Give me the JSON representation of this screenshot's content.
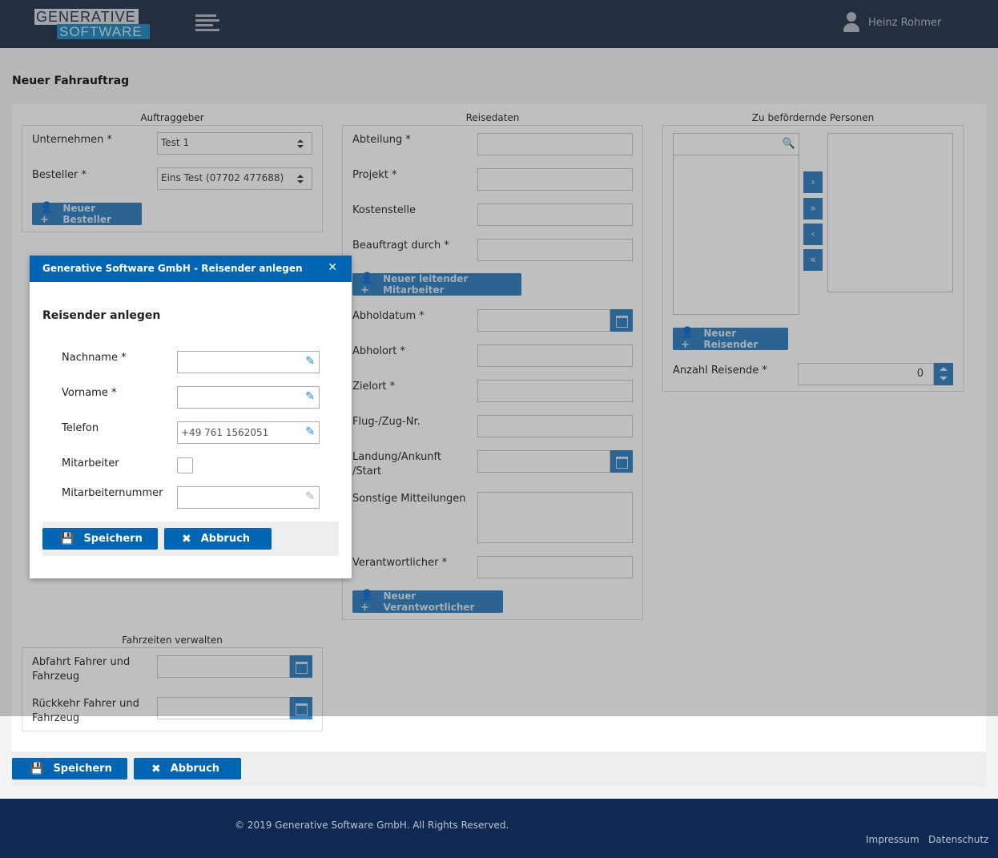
{
  "header": {
    "logo_top": "GENERATIVE",
    "logo_bottom": "SOFTWARE",
    "user_name": "Heinz Rohmer"
  },
  "page": {
    "title": "Neuer Fahrauftrag"
  },
  "auftraggeber": {
    "title": "Auftraggeber",
    "unternehmen_label": "Unternehmen  *",
    "unternehmen_value": "Test 1",
    "besteller_label": "Besteller  *",
    "besteller_value": "Eins Test (07702 477688)",
    "neuer_besteller": "Neuer Besteller"
  },
  "reisedaten": {
    "title": "Reisedaten",
    "abteilung": "Abteilung  *",
    "projekt": "Projekt  *",
    "kostenstelle": "Kostenstelle",
    "beauftragt": "Beauftragt durch  *",
    "neuer_leitender": "Neuer leitender Mitarbeiter",
    "abholdatum": "Abholdatum  *",
    "abholort": "Abholort  *",
    "zielort": "Zielort  *",
    "flug": "Flug-/Zug-Nr.",
    "landung_1": "Landung/Ankunft",
    "landung_2": "/Start",
    "sonstige": "Sonstige Mitteilungen",
    "verantwortlicher": "Verantwortlicher  *",
    "neuer_verantwortlicher": "Neuer Verantwortlicher"
  },
  "personen": {
    "title": "Zu befördernde Personen",
    "neuer_reisender": "Neuer Reisender",
    "anzahl_label": "Anzahl Reisende  *",
    "anzahl_value": "0"
  },
  "fahrzeiten": {
    "title": "Fahrzeiten verwalten",
    "abfahrt_1": "Abfahrt Fahrer und",
    "abfahrt_2": "Fahrzeug",
    "rueckkehr_1": "Rückkehr Fahrer und",
    "rueckkehr_2": "Fahrzeug"
  },
  "actions": {
    "save": "Speichern",
    "cancel": "Abbruch"
  },
  "footer": {
    "copyright": "© 2019 Generative Software GmbH. All Rights Reserved.",
    "impressum": "Impressum",
    "datenschutz": "Datenschutz"
  },
  "modal": {
    "header": "Generative Software GmbH - Reisender anlegen",
    "title": "Reisender anlegen",
    "nachname": "Nachname  *",
    "vorname": "Vorname  *",
    "telefon": "Telefon",
    "telefon_value": "+49 761 1562051",
    "mitarbeiter": "Mitarbeiter",
    "mitarbeiternummer": "Mitarbeiternummer",
    "save": "Speichern",
    "cancel": "Abbruch"
  }
}
